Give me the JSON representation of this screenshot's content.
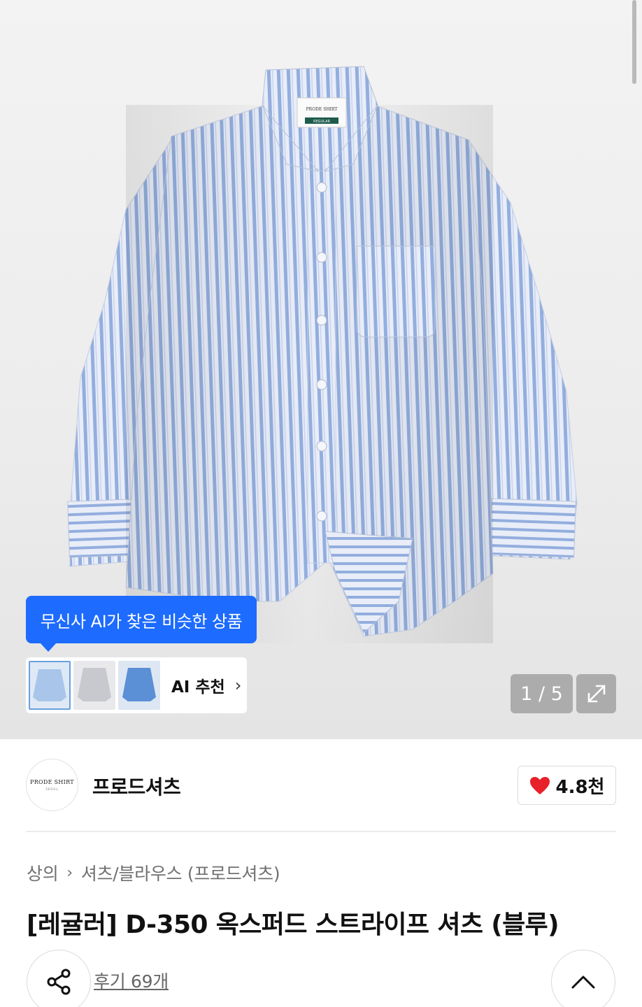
{
  "hero": {
    "ai_tooltip": "무신사 AI가 찾은 비슷한 상품",
    "ai_recommend_label": "AI 추천",
    "page_counter": "1 / 5",
    "shirt_label_brand": "PRODE SHIRT",
    "shirt_label_fit": "REGULAR"
  },
  "brand": {
    "logo_text": "PRODE SHIRT",
    "logo_sub": "SEOUL",
    "name": "프로드셔츠",
    "likes": "4.8천"
  },
  "product": {
    "breadcrumb": [
      "상의",
      "셔츠/블라우스 (프로드셔츠)"
    ],
    "title": "[레귤러] D-350 옥스퍼드 스트라이프 셔츠 (블루)",
    "reviews": "후기 69개"
  },
  "colors": {
    "accent_blue": "#1d6bff",
    "heart_red": "#e8202a",
    "shirt_stripe": "#8fa9de",
    "shirt_base": "#e9eef9"
  },
  "icons": [
    "share-icon",
    "chevron-up-icon",
    "heart-icon",
    "expand-icon",
    "chevron-right-icon"
  ]
}
